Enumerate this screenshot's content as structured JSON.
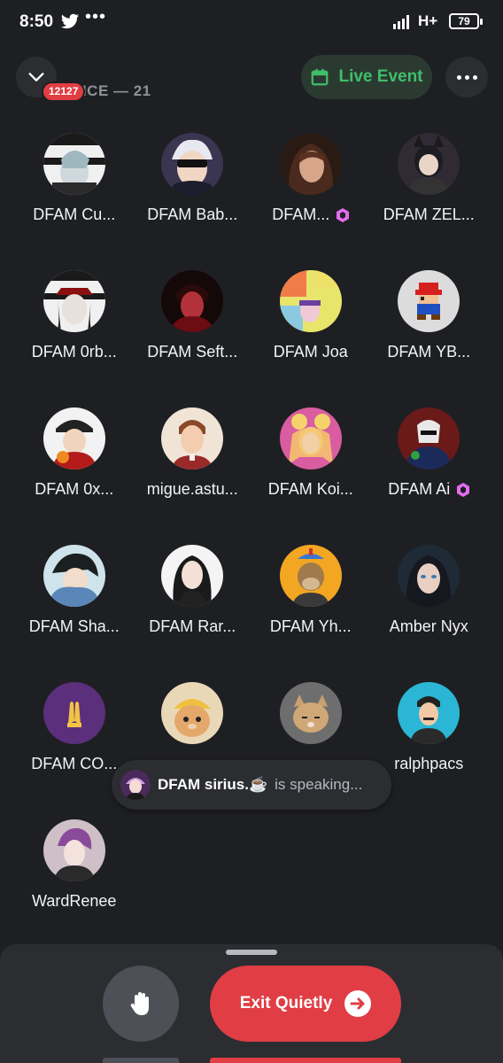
{
  "status_bar": {
    "time": "8:50",
    "dots": "•••",
    "network": "H+",
    "battery": "79"
  },
  "header": {
    "title": "AUDIENCE — 21",
    "badge": "12127",
    "live_event_label": "Live Event"
  },
  "members": [
    {
      "name": "DFAM Cu...",
      "avatar": "avatar-1"
    },
    {
      "name": "DFAM Bab...",
      "avatar": "avatar-2"
    },
    {
      "name": "DFAM...",
      "avatar": "avatar-3",
      "boost": true
    },
    {
      "name": "DFAM ZEL...",
      "avatar": "avatar-4"
    },
    {
      "name": "DFAM 0rb...",
      "avatar": "avatar-5"
    },
    {
      "name": "DFAM Seft...",
      "avatar": "avatar-6"
    },
    {
      "name": "DFAM Joa",
      "avatar": "avatar-7"
    },
    {
      "name": "DFAM YB...",
      "avatar": "avatar-8"
    },
    {
      "name": "DFAM 0x...",
      "avatar": "avatar-9"
    },
    {
      "name": "migue.astu...",
      "avatar": "avatar-10"
    },
    {
      "name": "DFAM Koi...",
      "avatar": "avatar-11"
    },
    {
      "name": "DFAM Ai",
      "avatar": "avatar-12",
      "boost": true
    },
    {
      "name": "DFAM Sha...",
      "avatar": "avatar-13"
    },
    {
      "name": "DFAM Rar...",
      "avatar": "avatar-14"
    },
    {
      "name": "DFAM Yh...",
      "avatar": "avatar-15"
    },
    {
      "name": "Amber Nyx",
      "avatar": "avatar-16"
    },
    {
      "name": "DFAM CO...",
      "avatar": "avatar-17"
    },
    {
      "name": "",
      "avatar": "avatar-18"
    },
    {
      "name": "",
      "avatar": "avatar-19"
    },
    {
      "name": "ralphpacs",
      "avatar": "avatar-20"
    },
    {
      "name": "WardRenee",
      "avatar": "avatar-21"
    }
  ],
  "speaking_toast": {
    "name": "DFAM sirius.☕",
    "text": "is speaking..."
  },
  "bottom_bar": {
    "exit_label": "Exit Quietly"
  },
  "colors": {
    "background": "#1e1f22",
    "sheet": "#2b2d31",
    "danger": "#e03d44",
    "live_green": "#3fbf6a",
    "boost_pink": "#e36cf0"
  }
}
